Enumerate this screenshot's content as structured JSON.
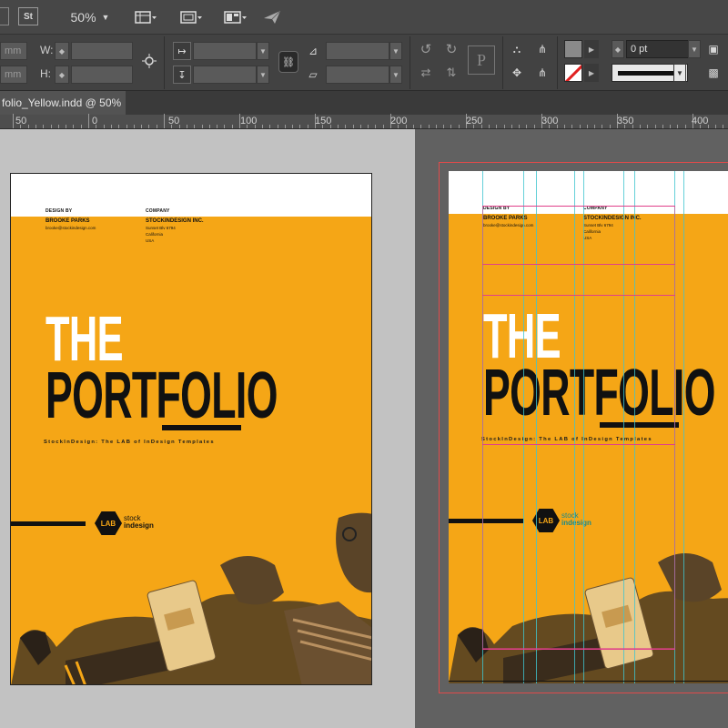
{
  "control_panel": {
    "zoom": "50%",
    "bridge_label": "St",
    "unit_placeholder": "mm",
    "w_label": "W:",
    "h_label": "H:",
    "stroke_weight": "0 pt",
    "p_icon_label": "P"
  },
  "document_tab": {
    "title": "folio_Yellow.indd @ 50%"
  },
  "ruler": {
    "marks": [
      "50",
      "0",
      "50",
      "100",
      "150",
      "200",
      "250",
      "300",
      "350",
      "400"
    ]
  },
  "page": {
    "design_by_label": "DESIGN BY",
    "designer_name": "BROOKE PARKS",
    "designer_email": "brooke@stockindesign.com",
    "company_label": "COMPANY",
    "company_name": "STOCKINDESIGN INC.",
    "company_address": [
      "Sunset Blv 6794",
      "California",
      "USA"
    ],
    "title_line1": "THE",
    "title_line2": "PORTFOLIO",
    "tagline": "StockInDesign: The LAB of InDesign Templates",
    "logo_badge": "LAB",
    "logo_line1": "stock",
    "logo_line2": "indesign"
  },
  "colors": {
    "accent_yellow": "#f5a616",
    "margin_guide": "#e0408a",
    "column_guide": "#3ec4d0",
    "bleed_guide": "#e04a4a"
  },
  "icons": [
    "grid-view-icon",
    "screen-mode-icon",
    "arrange-documents-icon",
    "publish-online-icon",
    "rotate-icon",
    "flip-icon",
    "constrain-link-icon",
    "stroke-swatch-icon",
    "fill-swatch-icon"
  ]
}
